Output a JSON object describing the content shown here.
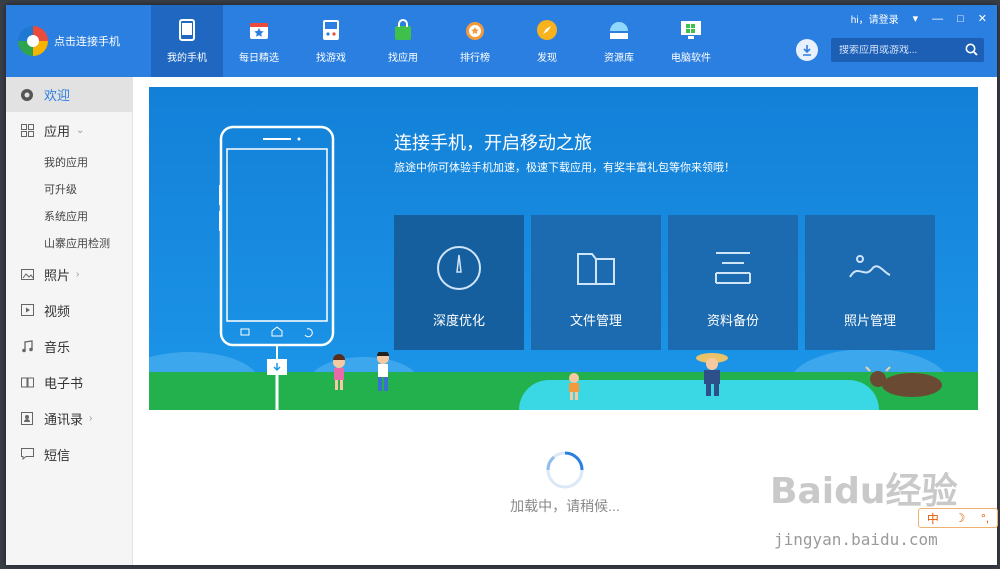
{
  "header": {
    "connect_text": "点击连接手机",
    "login_text": "hi，请登录",
    "search_placeholder": "搜索应用或游戏..."
  },
  "nav": [
    {
      "label": "我的手机",
      "icon": "phone-icon",
      "active": true
    },
    {
      "label": "每日精选",
      "icon": "calendar-star-icon"
    },
    {
      "label": "找游戏",
      "icon": "gamepad-icon"
    },
    {
      "label": "找应用",
      "icon": "shopping-bag-icon"
    },
    {
      "label": "排行榜",
      "icon": "medal-icon"
    },
    {
      "label": "发现",
      "icon": "compass-icon"
    },
    {
      "label": "资源库",
      "icon": "library-icon"
    },
    {
      "label": "电脑软件",
      "icon": "monitor-windows-icon"
    }
  ],
  "sidebar": {
    "welcome": "欢迎",
    "apps": "应用",
    "app_subs": [
      "我的应用",
      "可升级",
      "系统应用",
      "山寨应用检测"
    ],
    "photos": "照片",
    "video": "视频",
    "music": "音乐",
    "ebook": "电子书",
    "contacts": "通讯录",
    "sms": "短信"
  },
  "banner": {
    "title": "连接手机，开启移动之旅",
    "subtitle": "旅途中你可体验手机加速，极速下载应用，有奖丰富礼包等你来领哦！",
    "tiles": [
      "深度优化",
      "文件管理",
      "资料备份",
      "照片管理"
    ]
  },
  "loading_text": "加载中，请稍候...",
  "watermark": {
    "brand": "Baidu经验",
    "url": "jingyan.baidu.com"
  },
  "ime": {
    "label": "中"
  },
  "colors": {
    "accent": "#2b7fe0",
    "active_nav": "#1f67c0",
    "banner": "#1788df",
    "grass": "#22b14c"
  }
}
